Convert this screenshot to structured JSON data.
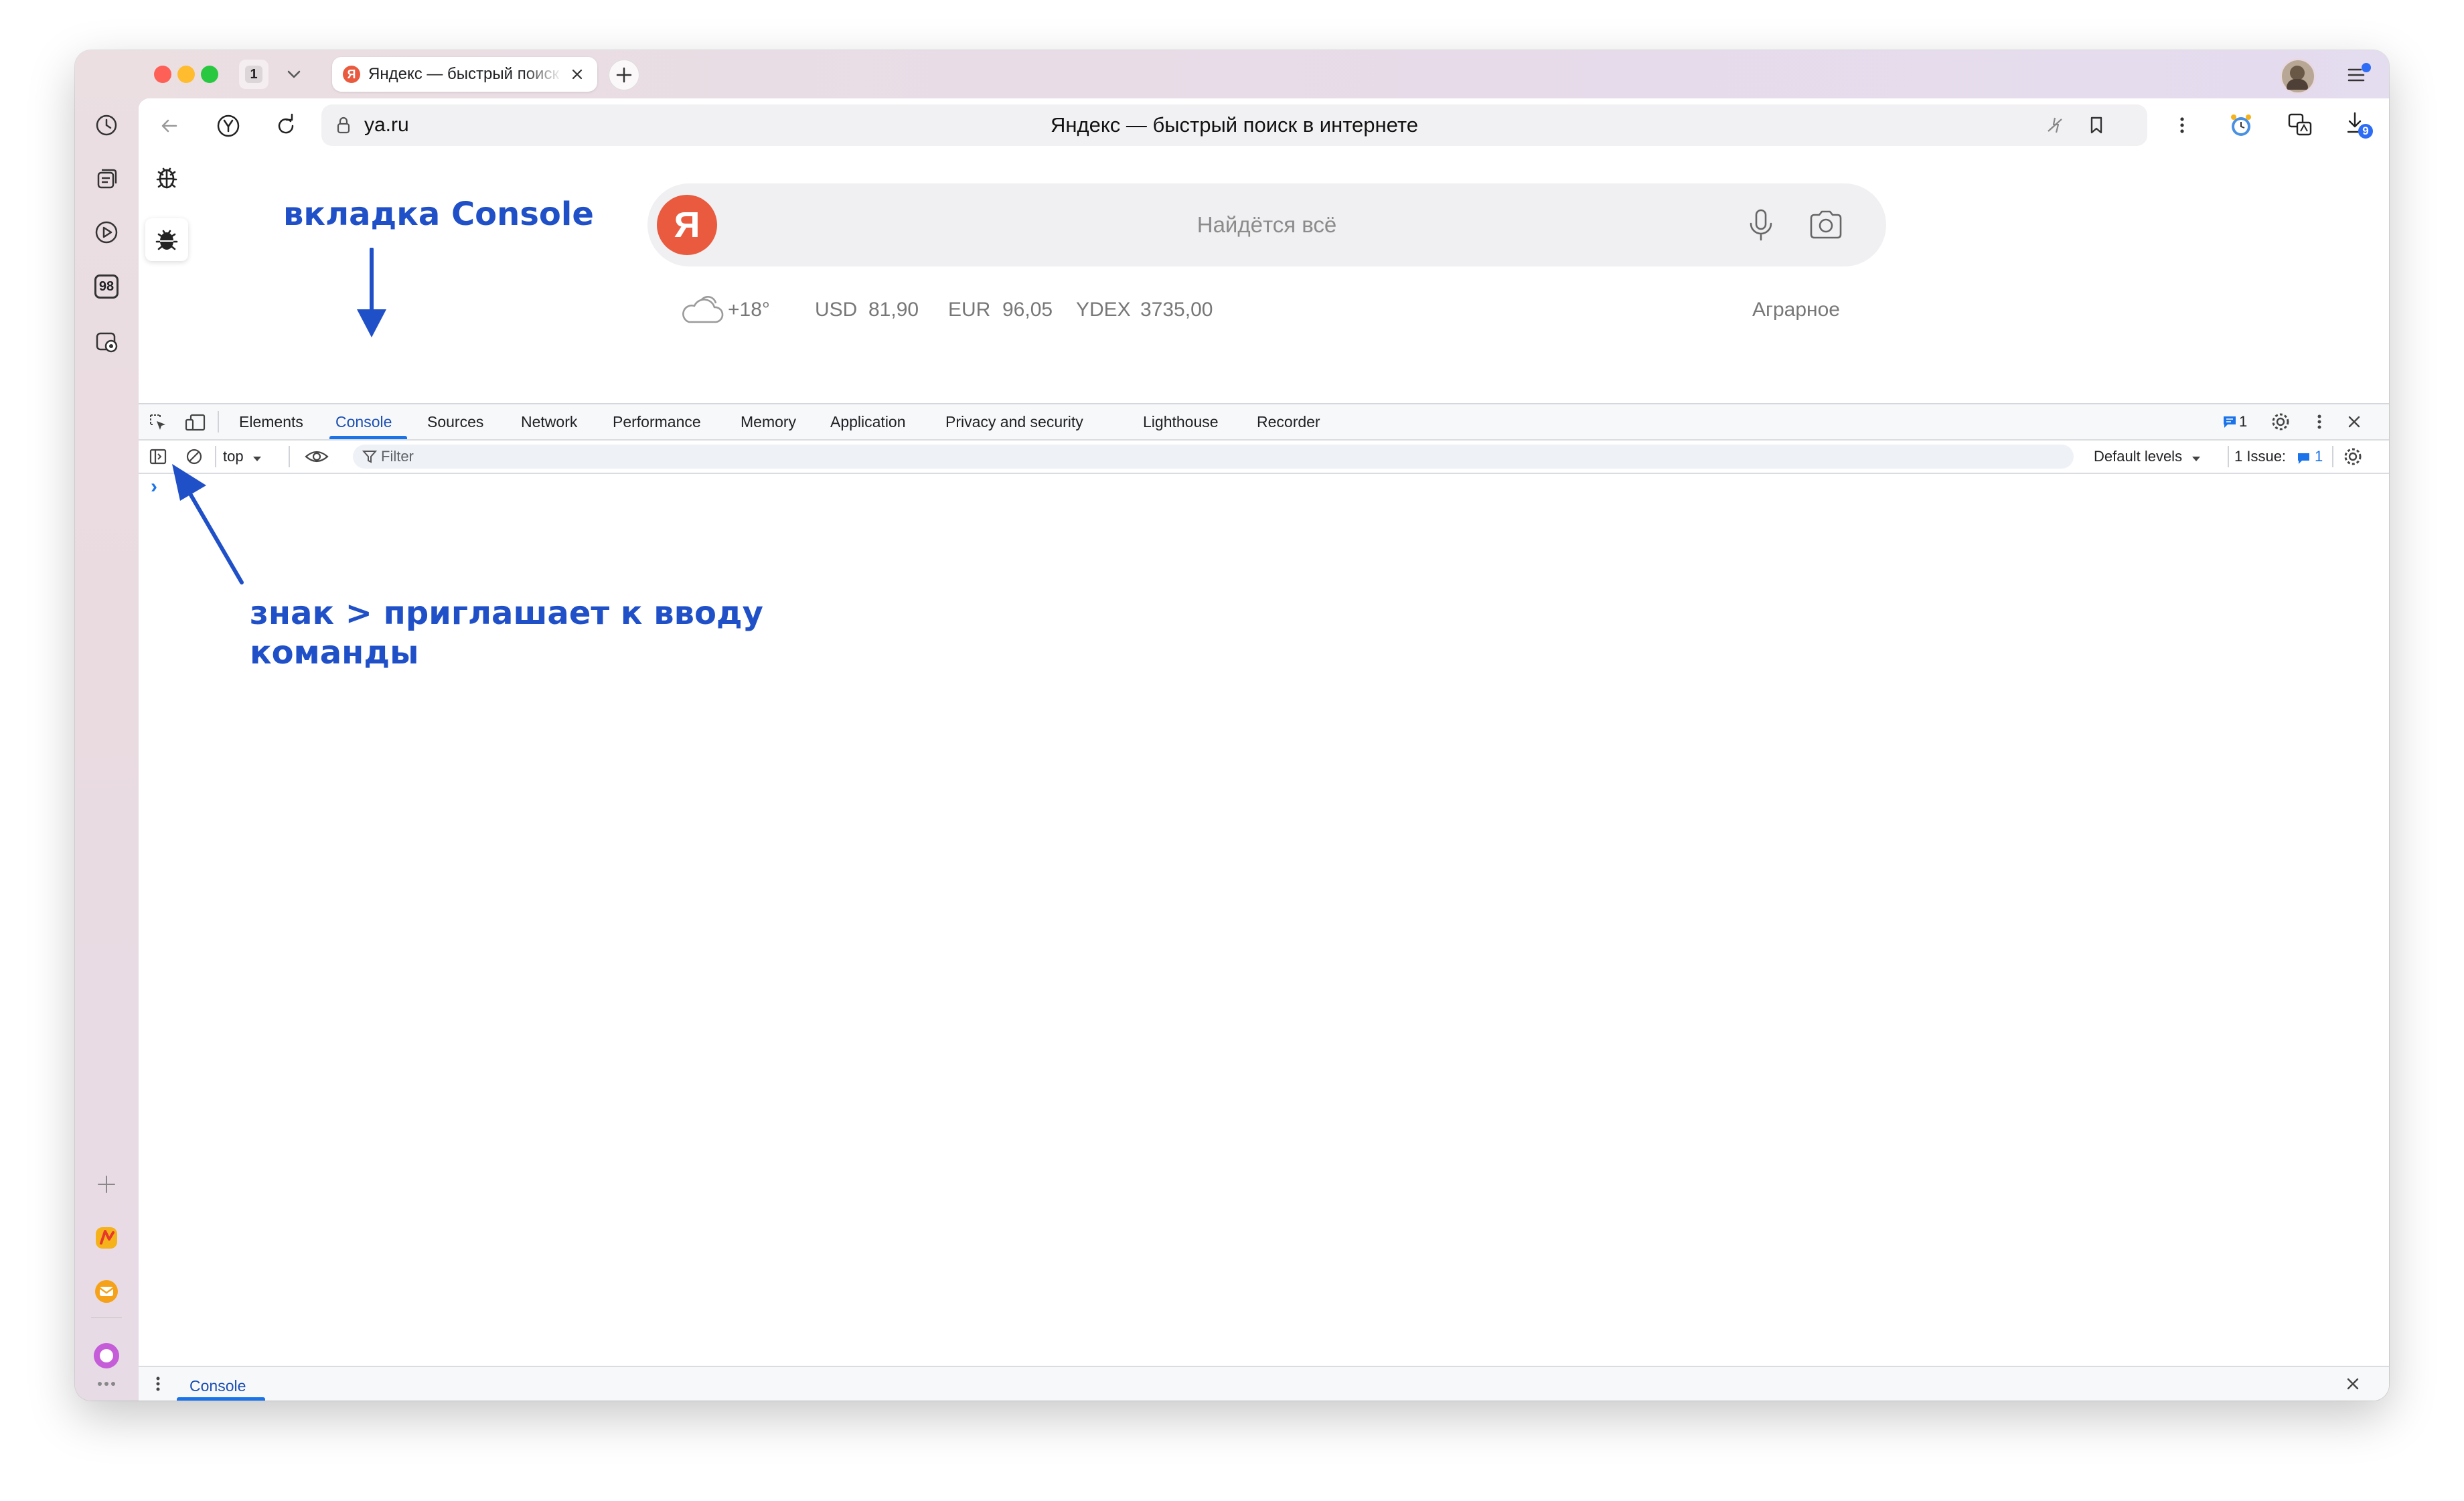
{
  "window": {
    "tab_count": "1",
    "active_tab": {
      "title": "Яндекс — быстрый поиск в интернете",
      "favicon": "yandex-favicon"
    }
  },
  "address": {
    "url": "ya.ru",
    "page_title": "Яндекс — быстрый поиск в интернете",
    "downloads_badge": "9"
  },
  "sidebar": {
    "badge_number": "98"
  },
  "page": {
    "logo_letter": "Я",
    "search_placeholder": "Найдётся всё",
    "weather": "+18°",
    "usd_label": "USD",
    "usd_value": "81,90",
    "eur_label": "EUR",
    "eur_value": "96,05",
    "ydex_label": "YDEX",
    "ydex_value": "3735,00",
    "location": "Аграрное"
  },
  "devtools": {
    "tabs": [
      "Elements",
      "Console",
      "Sources",
      "Network",
      "Performance",
      "Memory",
      "Application",
      "Privacy and security",
      "Lighthouse",
      "Recorder"
    ],
    "active_tab": "Console",
    "messages_count": "1",
    "context": "top",
    "filter_placeholder": "Filter",
    "levels": "Default levels",
    "issues_label": "1 Issue:",
    "issues_count": "1",
    "prompt": "›",
    "drawer_tab": "Console"
  },
  "annotations": {
    "console_tab": "вкладка Console",
    "prompt_line1": "знак > приглашает к вводу",
    "prompt_line2": "команды"
  },
  "colors": {
    "accent": "#1a73e8",
    "annotation": "#2050c8",
    "yandex_red": "#e95a3e"
  }
}
